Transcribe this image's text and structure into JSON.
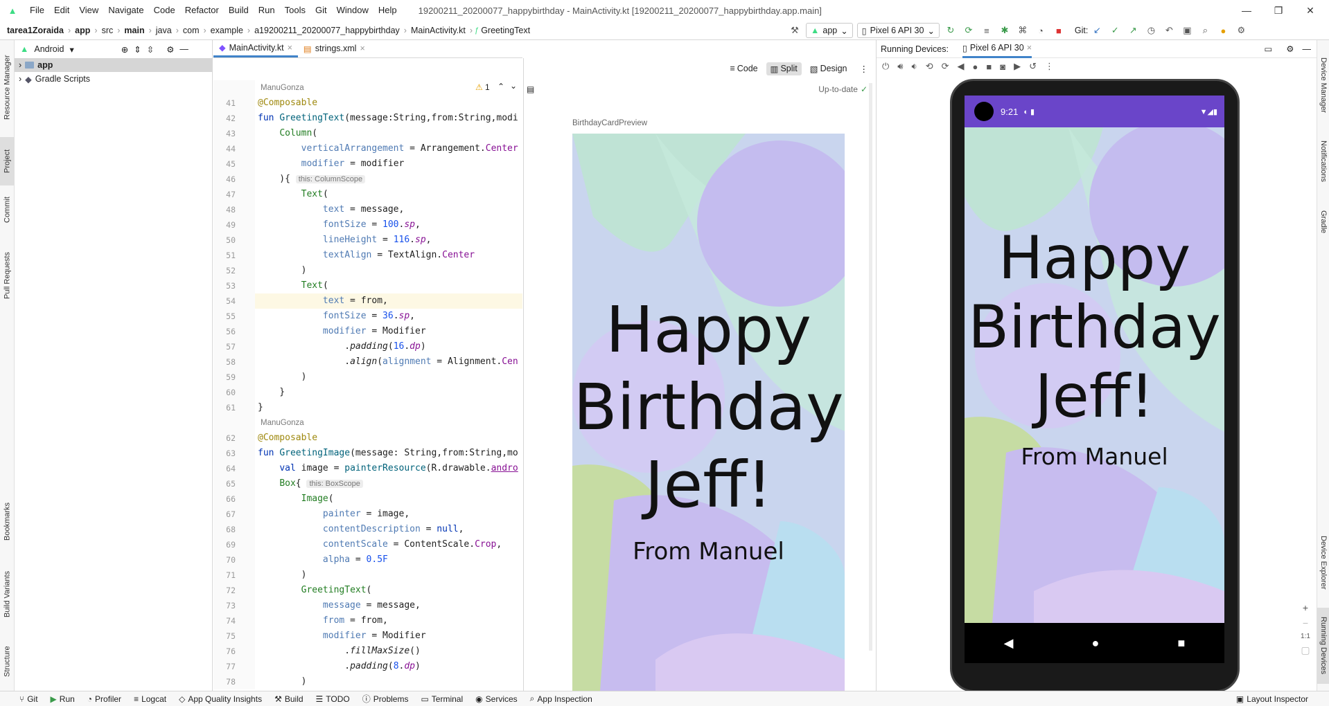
{
  "titlebar": {
    "menus": [
      "File",
      "Edit",
      "View",
      "Navigate",
      "Code",
      "Refactor",
      "Build",
      "Run",
      "Tools",
      "Git",
      "Window",
      "Help"
    ],
    "title": "19200211_20200077_happybirthday - MainActivity.kt [19200211_20200077_happybirthday.app.main]"
  },
  "navbar": {
    "crumbs": [
      "tarea1Zoraida",
      "app",
      "src",
      "main",
      "java",
      "com",
      "example",
      "a19200211_20200077_happybirthday",
      "MainActivity.kt",
      "GreetingText"
    ],
    "run_config": "app",
    "device": "Pixel 6 API 30",
    "git_label": "Git:"
  },
  "leftstripe": [
    "Resource Manager",
    "Project",
    "Commit",
    "Pull Requests",
    "Bookmarks",
    "Build Variants",
    "Structure"
  ],
  "project": {
    "view": "Android",
    "items": [
      {
        "label": "app"
      },
      {
        "label": "Gradle Scripts"
      }
    ]
  },
  "editor": {
    "tabs": [
      "MainActivity.kt",
      "strings.xml"
    ],
    "warnings": "1",
    "status": "Up-to-date",
    "authors": [
      "ManuGonza",
      "ManuGonza"
    ],
    "line_numbers": [
      "41",
      "42",
      "43",
      "44",
      "45",
      "46",
      "47",
      "48",
      "49",
      "50",
      "51",
      "52",
      "53",
      "54",
      "55",
      "56",
      "57",
      "58",
      "59",
      "60",
      "61",
      "62",
      "63",
      "64",
      "65",
      "66",
      "67",
      "68",
      "69",
      "70",
      "71",
      "72",
      "73",
      "74",
      "75",
      "76",
      "77",
      "78"
    ],
    "hints": [
      "this: ColumnScope",
      "this: BoxScope"
    ]
  },
  "preview": {
    "modes": [
      "Code",
      "Split",
      "Design"
    ],
    "preview_name": "BirthdayCardPreview",
    "greeting_1": "Happy",
    "greeting_2": "Birthday",
    "greeting_3": "Jeff!",
    "from": "From Manuel"
  },
  "running_devices": {
    "label": "Running Devices:",
    "tab": "Pixel 6 API 30",
    "time": "9:21",
    "greeting_1": "Happy",
    "greeting_2": "Birthday",
    "greeting_3": "Jeff!",
    "from": "From Manuel",
    "zoom": "1:1"
  },
  "rightstripe": [
    "Device Manager",
    "Notifications",
    "Gradle",
    "Device Explorer",
    "Running Devices"
  ],
  "bottombar": [
    "Git",
    "Run",
    "Profiler",
    "Logcat",
    "App Quality Insights",
    "Build",
    "TODO",
    "Problems",
    "Terminal",
    "Services",
    "App Inspection",
    "Layout Inspector"
  ]
}
